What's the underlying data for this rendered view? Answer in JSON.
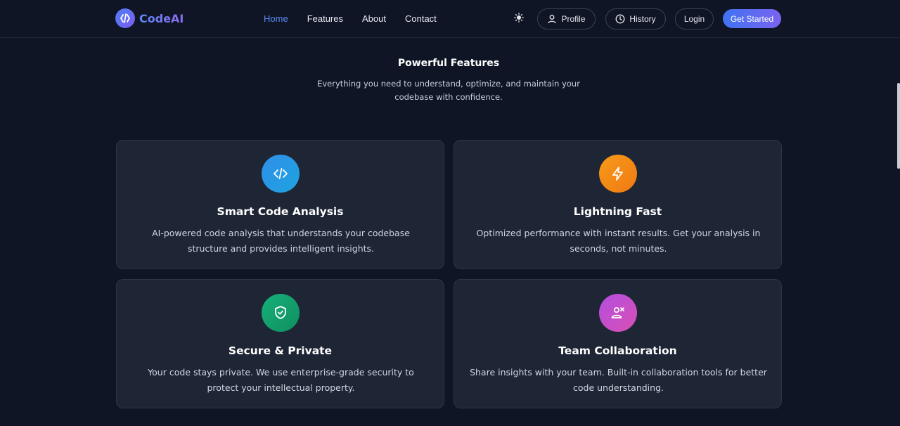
{
  "brand": {
    "name": "CodeAI",
    "accent": "#5b8af7"
  },
  "nav": {
    "links": [
      {
        "label": "Home",
        "active": true
      },
      {
        "label": "Features",
        "active": false
      },
      {
        "label": "About",
        "active": false
      },
      {
        "label": "Contact",
        "active": false
      }
    ],
    "profile_label": "Profile",
    "history_label": "History",
    "login_label": "Login",
    "get_started_label": "Get Started"
  },
  "section": {
    "title": "Powerful Features",
    "subtitle": "Everything you need to understand, optimize, and maintain your codebase with confidence."
  },
  "features": [
    {
      "icon": "code-icon",
      "color": "#2f8fe8",
      "title": "Smart Code Analysis",
      "description": "AI-powered code analysis that understands your codebase structure and provides intelligent insights."
    },
    {
      "icon": "lightning-icon",
      "color": "#f58a16",
      "title": "Lightning Fast",
      "description": "Optimized performance with instant results. Get your analysis in seconds, not minutes."
    },
    {
      "icon": "shield-check-icon",
      "color": "#14a06e",
      "title": "Secure & Private",
      "description": "Your code stays private. We use enterprise-grade security to protect your intellectual property."
    },
    {
      "icon": "team-icon",
      "color": "#c04fd6",
      "title": "Team Collaboration",
      "description": "Share insights with your team. Built-in collaboration tools for better code understanding."
    }
  ]
}
